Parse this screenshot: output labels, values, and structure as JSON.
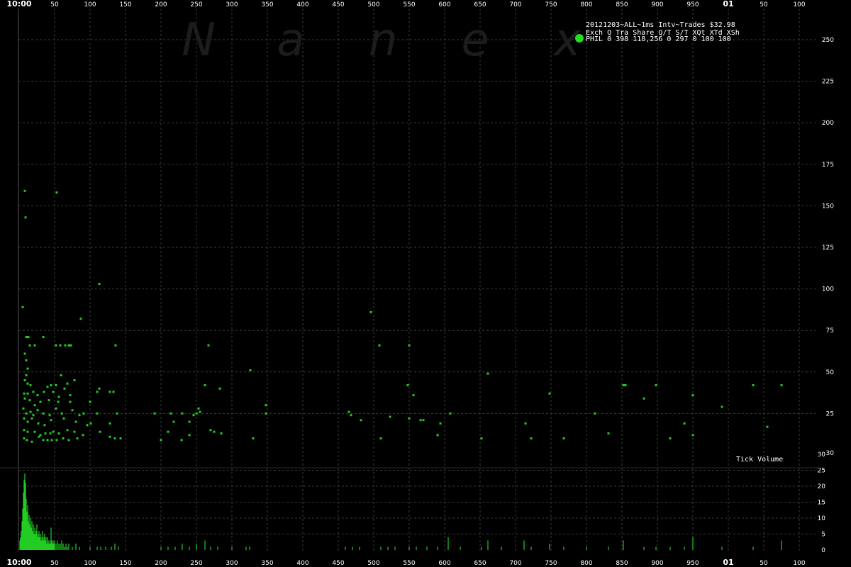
{
  "chart_data": {
    "type": "scatter",
    "title": "20121203~ALL~1ms Intv~Trades $32.98",
    "watermark": [
      "N",
      "a",
      "n",
      "e",
      "x"
    ],
    "legend": {
      "header": "Exch Q Tra   Share  Q/T   S/T  XQt XTd XSh",
      "row": "PHIL 0 398 118,256     0   297    0 100 100",
      "marker_color": "#22dd22"
    },
    "x_ticks": [
      "10:00",
      "50",
      "100",
      "150",
      "200",
      "250",
      "300",
      "350",
      "400",
      "450",
      "500",
      "550",
      "600",
      "650",
      "700",
      "750",
      "800",
      "850",
      "900",
      "950",
      "01",
      "50",
      "100"
    ],
    "x_bold_ticks": [
      "10:00",
      "01"
    ],
    "x_range_ms": [
      0,
      1100
    ],
    "upper_panel": {
      "y_ticks": [
        25,
        50,
        75,
        100,
        125,
        150,
        175,
        200,
        225,
        250
      ],
      "bottom_label": 30,
      "ylim": [
        0,
        260
      ],
      "series_color": "#22cc22",
      "points": [
        [
          8,
          159
        ],
        [
          53,
          158
        ],
        [
          9,
          143
        ],
        [
          113,
          103
        ],
        [
          5,
          89
        ],
        [
          496,
          86
        ],
        [
          87,
          82
        ],
        [
          10,
          71
        ],
        [
          13,
          71
        ],
        [
          34,
          71
        ],
        [
          15,
          66
        ],
        [
          22,
          66
        ],
        [
          52,
          66
        ],
        [
          58,
          66
        ],
        [
          65,
          66
        ],
        [
          70,
          66
        ],
        [
          73,
          66
        ],
        [
          136,
          66
        ],
        [
          267,
          66
        ],
        [
          508,
          66
        ],
        [
          550,
          66
        ],
        [
          8,
          61
        ],
        [
          10,
          57
        ],
        [
          12,
          52
        ],
        [
          10,
          48
        ],
        [
          59,
          48
        ],
        [
          326,
          51
        ],
        [
          661,
          49
        ],
        [
          8,
          45
        ],
        [
          12,
          43
        ],
        [
          16,
          42
        ],
        [
          40,
          41
        ],
        [
          45,
          42
        ],
        [
          52,
          42
        ],
        [
          68,
          43
        ],
        [
          78,
          45
        ],
        [
          113,
          40
        ],
        [
          262,
          42
        ],
        [
          283,
          40
        ],
        [
          548,
          42
        ],
        [
          852,
          42
        ],
        [
          855,
          42
        ],
        [
          898,
          42
        ],
        [
          1035,
          42
        ],
        [
          1075,
          42
        ],
        [
          7,
          37
        ],
        [
          12,
          37
        ],
        [
          20,
          38
        ],
        [
          26,
          36
        ],
        [
          35,
          38
        ],
        [
          48,
          38
        ],
        [
          56,
          35
        ],
        [
          64,
          40
        ],
        [
          72,
          36
        ],
        [
          110,
          38
        ],
        [
          128,
          38
        ],
        [
          133,
          38
        ],
        [
          748,
          37
        ],
        [
          556,
          36
        ],
        [
          881,
          34
        ],
        [
          950,
          36
        ],
        [
          8,
          34
        ],
        [
          15,
          33
        ],
        [
          22,
          30
        ],
        [
          30,
          32
        ],
        [
          42,
          33
        ],
        [
          55,
          32
        ],
        [
          72,
          32
        ],
        [
          100,
          32
        ],
        [
          348,
          30
        ],
        [
          991,
          29
        ],
        [
          6,
          28
        ],
        [
          10,
          25
        ],
        [
          16,
          26
        ],
        [
          20,
          24
        ],
        [
          26,
          27
        ],
        [
          34,
          25
        ],
        [
          43,
          24
        ],
        [
          52,
          28
        ],
        [
          60,
          25
        ],
        [
          75,
          27
        ],
        [
          85,
          24
        ],
        [
          91,
          25
        ],
        [
          110,
          25
        ],
        [
          138,
          25
        ],
        [
          191,
          25
        ],
        [
          214,
          25
        ],
        [
          250,
          25
        ],
        [
          253,
          28
        ],
        [
          255,
          26
        ],
        [
          230,
          25
        ],
        [
          348,
          25
        ],
        [
          465,
          26
        ],
        [
          468,
          24
        ],
        [
          812,
          25
        ],
        [
          608,
          25
        ],
        [
          246,
          24
        ],
        [
          7,
          22
        ],
        [
          12,
          20
        ],
        [
          18,
          22
        ],
        [
          27,
          19
        ],
        [
          36,
          18
        ],
        [
          45,
          21
        ],
        [
          63,
          22
        ],
        [
          80,
          20
        ],
        [
          96,
          18
        ],
        [
          101,
          19
        ],
        [
          128,
          19
        ],
        [
          218,
          20
        ],
        [
          240,
          20
        ],
        [
          482,
          21
        ],
        [
          550,
          22
        ],
        [
          523,
          23
        ],
        [
          566,
          21
        ],
        [
          570,
          21
        ],
        [
          594,
          19
        ],
        [
          938,
          19
        ],
        [
          714,
          19
        ],
        [
          1055,
          17
        ],
        [
          7,
          15
        ],
        [
          12,
          14
        ],
        [
          22,
          14
        ],
        [
          30,
          12
        ],
        [
          37,
          13
        ],
        [
          44,
          13
        ],
        [
          48,
          14
        ],
        [
          56,
          13
        ],
        [
          68,
          15
        ],
        [
          78,
          14
        ],
        [
          90,
          12
        ],
        [
          114,
          14
        ],
        [
          210,
          14
        ],
        [
          275,
          14
        ],
        [
          285,
          13
        ],
        [
          590,
          12
        ],
        [
          270,
          15
        ],
        [
          831,
          13
        ],
        [
          7,
          10
        ],
        [
          11,
          9
        ],
        [
          18,
          8
        ],
        [
          28,
          11
        ],
        [
          34,
          9
        ],
        [
          40,
          9
        ],
        [
          46,
          9
        ],
        [
          53,
          9
        ],
        [
          62,
          10
        ],
        [
          70,
          9
        ],
        [
          82,
          10
        ],
        [
          128,
          11
        ],
        [
          135,
          10
        ],
        [
          143,
          10
        ],
        [
          200,
          9
        ],
        [
          229,
          9
        ],
        [
          240,
          12
        ],
        [
          330,
          10
        ],
        [
          510,
          10
        ],
        [
          652,
          10
        ],
        [
          722,
          10
        ],
        [
          768,
          10
        ],
        [
          918,
          10
        ],
        [
          950,
          12
        ]
      ]
    },
    "lower_panel": {
      "label": "Tick Volume",
      "y_ticks": [
        0,
        5,
        10,
        15,
        20,
        25,
        30
      ],
      "ylim": [
        0,
        30
      ],
      "series_color": "#22cc22",
      "bars": [
        [
          1,
          3
        ],
        [
          2,
          4
        ],
        [
          3,
          6
        ],
        [
          4,
          9
        ],
        [
          5,
          13
        ],
        [
          6,
          18
        ],
        [
          7,
          22
        ],
        [
          8,
          24
        ],
        [
          9,
          21
        ],
        [
          10,
          16
        ],
        [
          11,
          12
        ],
        [
          12,
          14
        ],
        [
          13,
          9
        ],
        [
          14,
          11
        ],
        [
          15,
          8
        ],
        [
          16,
          10
        ],
        [
          17,
          7
        ],
        [
          18,
          9
        ],
        [
          19,
          6
        ],
        [
          20,
          8
        ],
        [
          21,
          5
        ],
        [
          22,
          7
        ],
        [
          23,
          5
        ],
        [
          24,
          6
        ],
        [
          25,
          8
        ],
        [
          26,
          4
        ],
        [
          27,
          5
        ],
        [
          28,
          6
        ],
        [
          29,
          4
        ],
        [
          30,
          5
        ],
        [
          31,
          3
        ],
        [
          32,
          4
        ],
        [
          33,
          6
        ],
        [
          34,
          3
        ],
        [
          35,
          4
        ],
        [
          36,
          5
        ],
        [
          37,
          3
        ],
        [
          38,
          4
        ],
        [
          39,
          2
        ],
        [
          40,
          4
        ],
        [
          41,
          3
        ],
        [
          42,
          2
        ],
        [
          43,
          3
        ],
        [
          44,
          2
        ],
        [
          45,
          7
        ],
        [
          46,
          3
        ],
        [
          47,
          2
        ],
        [
          48,
          3
        ],
        [
          49,
          2
        ],
        [
          50,
          3
        ],
        [
          52,
          2
        ],
        [
          54,
          3
        ],
        [
          56,
          2
        ],
        [
          58,
          2
        ],
        [
          60,
          3
        ],
        [
          62,
          2
        ],
        [
          64,
          1
        ],
        [
          66,
          2
        ],
        [
          68,
          1
        ],
        [
          70,
          2
        ],
        [
          75,
          1
        ],
        [
          80,
          2
        ],
        [
          85,
          1
        ],
        [
          100,
          1
        ],
        [
          110,
          1
        ],
        [
          115,
          1
        ],
        [
          122,
          1
        ],
        [
          130,
          1
        ],
        [
          135,
          2
        ],
        [
          140,
          1
        ],
        [
          200,
          1
        ],
        [
          210,
          1
        ],
        [
          220,
          1
        ],
        [
          230,
          2
        ],
        [
          240,
          1
        ],
        [
          250,
          2
        ],
        [
          262,
          3
        ],
        [
          270,
          1
        ],
        [
          280,
          1
        ],
        [
          300,
          1
        ],
        [
          320,
          1
        ],
        [
          325,
          1
        ],
        [
          460,
          1
        ],
        [
          470,
          1
        ],
        [
          480,
          1
        ],
        [
          510,
          1
        ],
        [
          520,
          1
        ],
        [
          530,
          1
        ],
        [
          550,
          1
        ],
        [
          560,
          1
        ],
        [
          575,
          1
        ],
        [
          590,
          1
        ],
        [
          605,
          4
        ],
        [
          622,
          1
        ],
        [
          652,
          1
        ],
        [
          661,
          3
        ],
        [
          680,
          1
        ],
        [
          712,
          3
        ],
        [
          722,
          1
        ],
        [
          748,
          2
        ],
        [
          768,
          1
        ],
        [
          800,
          1
        ],
        [
          831,
          1
        ],
        [
          852,
          3
        ],
        [
          881,
          1
        ],
        [
          898,
          1
        ],
        [
          918,
          1
        ],
        [
          938,
          1
        ],
        [
          950,
          4
        ],
        [
          991,
          1
        ],
        [
          1035,
          1
        ],
        [
          1075,
          3
        ]
      ]
    }
  }
}
